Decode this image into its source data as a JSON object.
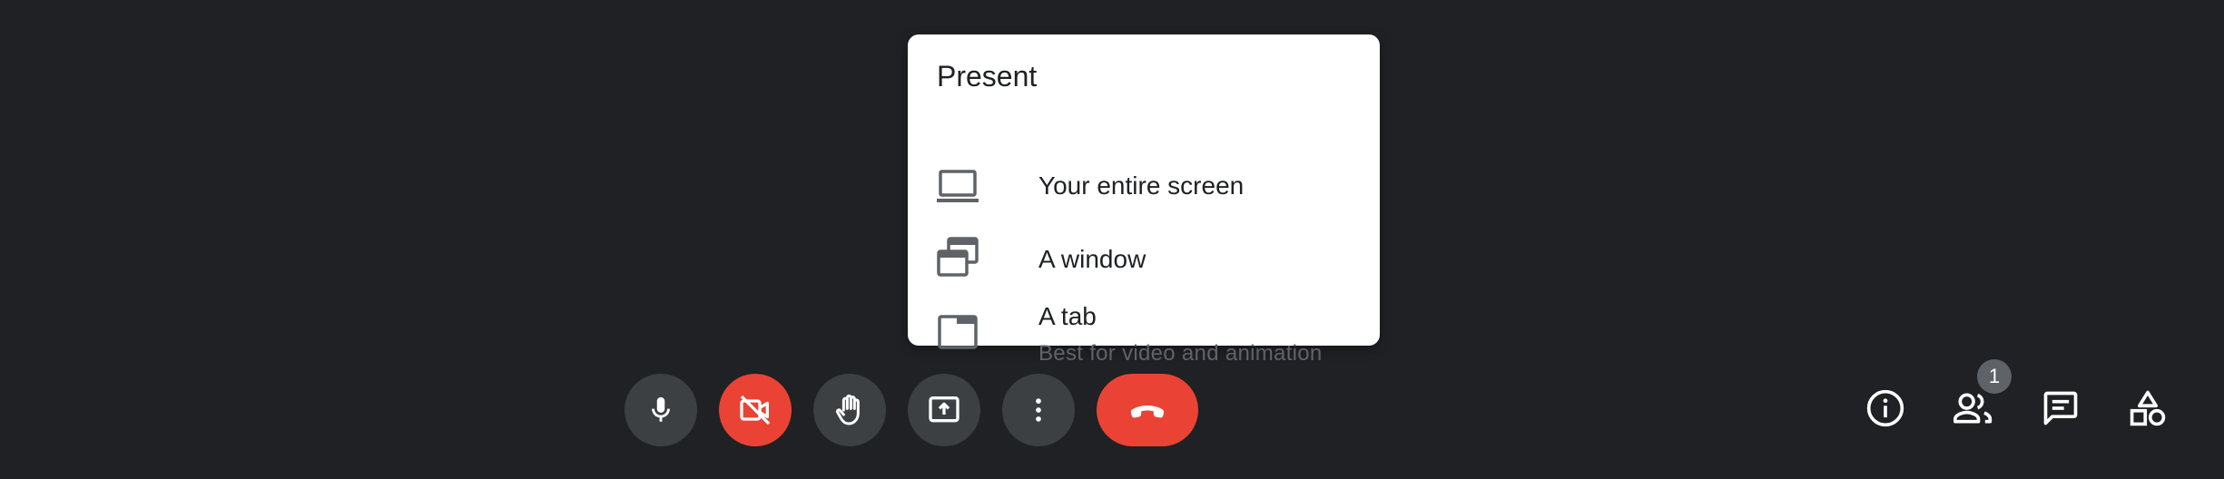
{
  "present_menu": {
    "title": "Present",
    "items": [
      {
        "label": "Your entire screen",
        "icon": "laptop-icon"
      },
      {
        "label": "A window",
        "icon": "window-icon"
      },
      {
        "label": "A tab",
        "sublabel": "Best for video and animation",
        "icon": "tab-icon"
      }
    ]
  },
  "controls": {
    "microphone": {
      "icon": "microphone-icon",
      "state": "on"
    },
    "camera": {
      "icon": "camera-off-icon",
      "state": "off"
    },
    "raise_hand": {
      "icon": "hand-icon"
    },
    "present_now": {
      "icon": "present-screen-icon"
    },
    "more_options": {
      "icon": "more-vert-icon"
    },
    "leave_call": {
      "icon": "phone-hangup-icon"
    }
  },
  "side_controls": {
    "meeting_details": {
      "icon": "info-icon"
    },
    "people": {
      "icon": "people-icon",
      "badge": "1"
    },
    "chat": {
      "icon": "chat-icon"
    },
    "activities": {
      "icon": "shapes-icon"
    }
  },
  "colors": {
    "background": "#202124",
    "button": "#3c4043",
    "danger": "#ea4335",
    "badge": "#5f6368"
  }
}
